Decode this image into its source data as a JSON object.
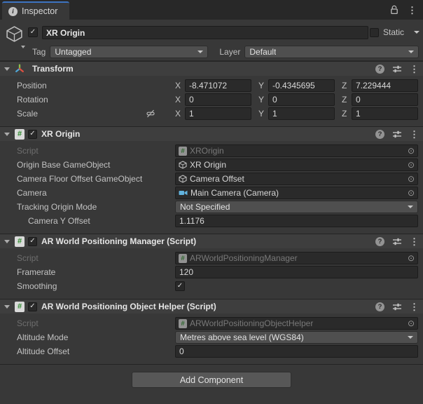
{
  "icons": {
    "info": "i",
    "help": "?",
    "kebab": "⋮",
    "picker": "⊙",
    "check": "✓"
  },
  "colors": {
    "tab_accent": "#3D74C2",
    "axis_green": "#8CC04C",
    "axis_blue": "#4FA6D5",
    "axis_red": "#DE5142",
    "camera_blue": "#62B3DE",
    "script_green": "#2E8B2E"
  },
  "tab": {
    "title": "Inspector"
  },
  "gameobject": {
    "name": "XR Origin",
    "static_label": "Static",
    "tag_label": "Tag",
    "tag_value": "Untagged",
    "layer_label": "Layer",
    "layer_value": "Default"
  },
  "transform": {
    "title": "Transform",
    "axis": {
      "x": "X",
      "y": "Y",
      "z": "Z"
    },
    "rows": [
      {
        "label": "Position",
        "x": "-8.471072",
        "y": "-0.4345695",
        "z": "7.229444"
      },
      {
        "label": "Rotation",
        "x": "0",
        "y": "0",
        "z": "0"
      },
      {
        "label": "Scale",
        "x": "1",
        "y": "1",
        "z": "1"
      }
    ]
  },
  "xr_origin": {
    "title": "XR Origin",
    "rows": [
      {
        "label": "Script",
        "value": "XROrigin"
      },
      {
        "label": "Origin Base GameObject",
        "value": "XR Origin"
      },
      {
        "label": "Camera Floor Offset GameObject",
        "value": "Camera Offset"
      },
      {
        "label": "Camera",
        "value": "Main Camera (Camera)"
      },
      {
        "label": "Tracking Origin Mode",
        "value": "Not Specified"
      },
      {
        "label": "Camera Y Offset",
        "value": "1.1176"
      }
    ]
  },
  "wpm": {
    "title": "AR World Positioning Manager (Script)",
    "rows": [
      {
        "label": "Script",
        "value": "ARWorldPositioningManager"
      },
      {
        "label": "Framerate",
        "value": "120"
      },
      {
        "label": "Smoothing",
        "value": "checked"
      }
    ]
  },
  "wpoh": {
    "title": "AR World Positioning Object Helper (Script)",
    "rows": [
      {
        "label": "Script",
        "value": "ARWorldPositioningObjectHelper"
      },
      {
        "label": "Altitude Mode",
        "value": "Metres above sea level (WGS84)"
      },
      {
        "label": "Altitude Offset",
        "value": "0"
      }
    ]
  },
  "footer": {
    "add_component": "Add Component"
  }
}
